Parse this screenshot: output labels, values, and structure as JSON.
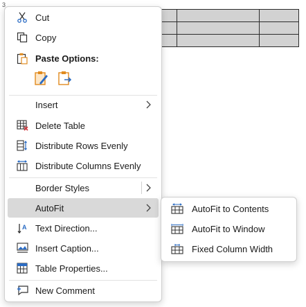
{
  "document": {
    "cursor_glyph": "3"
  },
  "context_menu": {
    "items": [
      {
        "label": "Cut",
        "icon": "scissors-icon"
      },
      {
        "label": "Copy",
        "icon": "copy-icon"
      },
      {
        "label": "Paste Options:",
        "icon": "paste-icon"
      },
      {
        "label": "Insert",
        "icon": ""
      },
      {
        "label": "Delete Table",
        "icon": "delete-table-icon"
      },
      {
        "label": "Distribute Rows Evenly",
        "icon": "distribute-rows-icon"
      },
      {
        "label": "Distribute Columns Evenly",
        "icon": "distribute-columns-icon"
      },
      {
        "label": "Border Styles",
        "icon": ""
      },
      {
        "label": "AutoFit",
        "icon": ""
      },
      {
        "label": "Text Direction...",
        "icon": "text-direction-icon"
      },
      {
        "label": "Insert Caption...",
        "icon": "insert-caption-icon"
      },
      {
        "label": "Table Properties...",
        "icon": "table-properties-icon"
      },
      {
        "label": "New Comment",
        "icon": "new-comment-icon"
      }
    ],
    "paste_options": [
      "keep-source-formatting-icon",
      "keep-text-only-icon"
    ]
  },
  "autofit_submenu": {
    "items": [
      {
        "label": "AutoFit to Contents",
        "icon": "autofit-contents-icon"
      },
      {
        "label": "AutoFit to Window",
        "icon": "autofit-window-icon"
      },
      {
        "label": "Fixed Column Width",
        "icon": "fixed-column-width-icon"
      }
    ]
  },
  "colors": {
    "accent_blue": "#2b6cc4",
    "hover": "#d9d9d9",
    "paste_orange": "#e08a1e",
    "delete_red": "#d0343a"
  }
}
